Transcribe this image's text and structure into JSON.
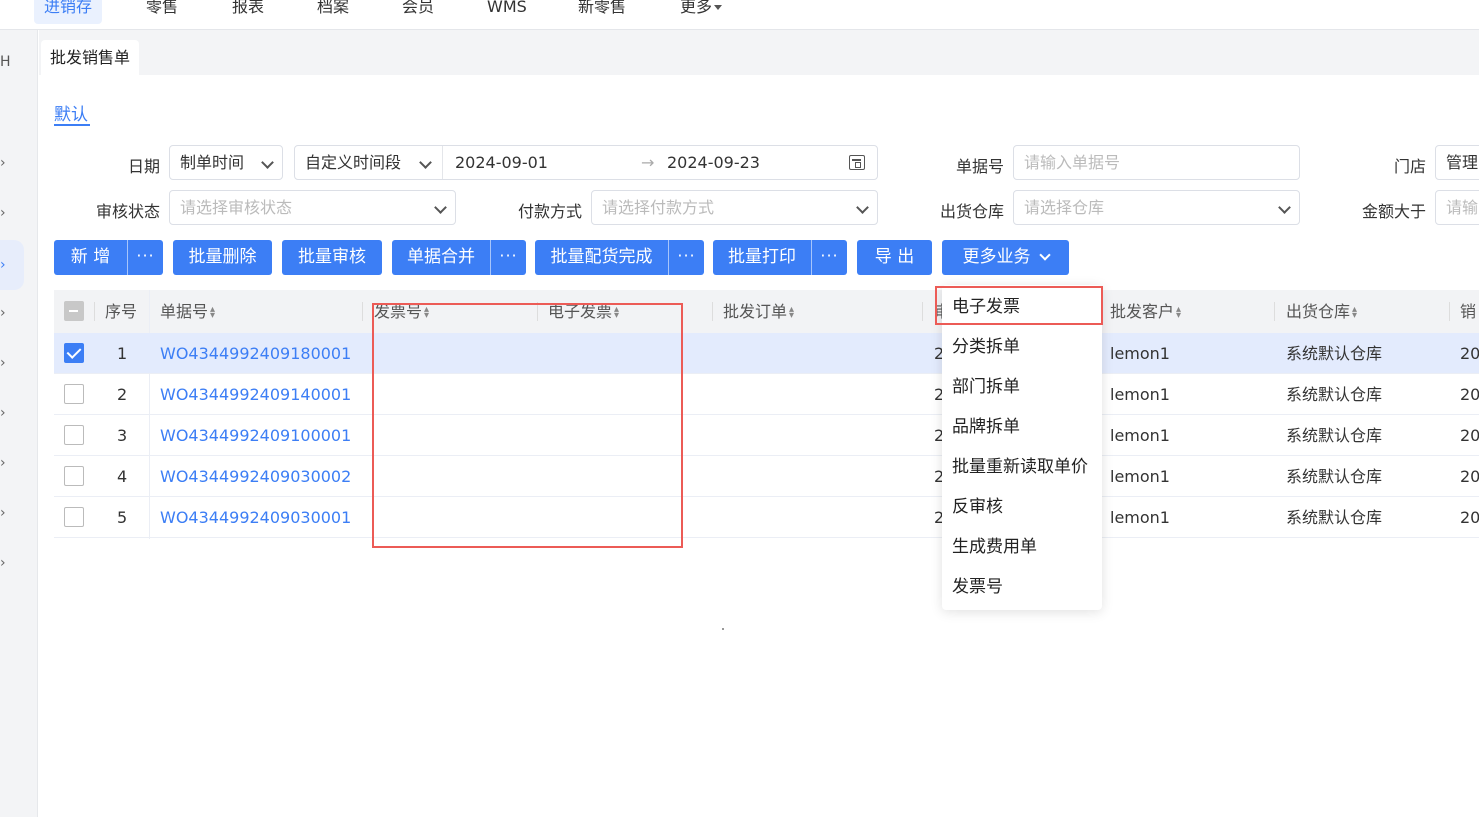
{
  "topnav": {
    "items": [
      "进销存",
      "零售",
      "报表",
      "档案",
      "会员",
      "WMS",
      "新零售",
      "更多"
    ],
    "active": "进销存"
  },
  "sidebar": {
    "letter": "H"
  },
  "page_tab": "批发销售单",
  "view_tab": "默认",
  "filters": {
    "date_label": "日期",
    "date_field": "制单时间",
    "date_range_type": "自定义时间段",
    "date_from": "2024-09-01",
    "date_sep": "→",
    "date_to": "2024-09-23",
    "doc_no_label": "单据号",
    "doc_no_placeholder": "请输入单据号",
    "store_label": "门店",
    "store_value": "管理",
    "audit_label": "审核状态",
    "audit_placeholder": "请选择审核状态",
    "payment_label": "付款方式",
    "payment_placeholder": "请选择付款方式",
    "warehouse_label": "出货仓库",
    "warehouse_placeholder": "请选择仓库",
    "amount_label": "金额大于",
    "amount_placeholder": "请输"
  },
  "toolbar": {
    "add": "新 增",
    "batch_delete": "批量删除",
    "batch_audit": "批量审核",
    "merge": "单据合并",
    "batch_pick": "批量配货完成",
    "batch_print": "批量打印",
    "export": "导 出",
    "more_business": "更多业务",
    "more_dots": "···"
  },
  "table": {
    "headers": {
      "seq": "序号",
      "doc_no": "单据号",
      "invoice_no": "发票号",
      "e_invoice": "电子发票",
      "wholesale_order": "批发订单",
      "audit_partial": "审",
      "customer": "批发客户",
      "warehouse": "出货仓库",
      "sales_partial": "销"
    },
    "rows": [
      {
        "seq": "1",
        "doc_no": "WO4344992409180001",
        "col_partial": "2",
        "customer": "lemon1",
        "warehouse": "系统默认仓库",
        "date_partial": "20",
        "checked": true
      },
      {
        "seq": "2",
        "doc_no": "WO4344992409140001",
        "col_partial": "2",
        "customer": "lemon1",
        "warehouse": "系统默认仓库",
        "date_partial": "20",
        "checked": false
      },
      {
        "seq": "3",
        "doc_no": "WO4344992409100001",
        "col_partial": "2",
        "customer": "lemon1",
        "warehouse": "系统默认仓库",
        "date_partial": "20",
        "checked": false
      },
      {
        "seq": "4",
        "doc_no": "WO4344992409030002",
        "col_partial": "2",
        "customer": "lemon1",
        "warehouse": "系统默认仓库",
        "date_partial": "20",
        "checked": false
      },
      {
        "seq": "5",
        "doc_no": "WO4344992409030001",
        "col_partial": "2",
        "customer": "lemon1",
        "warehouse": "系统默认仓库",
        "date_partial": "20",
        "checked": false
      }
    ]
  },
  "dropdown": {
    "items": [
      "电子发票",
      "分类拆单",
      "部门拆单",
      "品牌拆单",
      "批量重新读取单价",
      "反审核",
      "生成费用单",
      "发票号"
    ]
  },
  "colors": {
    "primary": "#3c7ef5",
    "highlight_red": "#ec5b56",
    "selected_row": "#e3ebfd"
  }
}
